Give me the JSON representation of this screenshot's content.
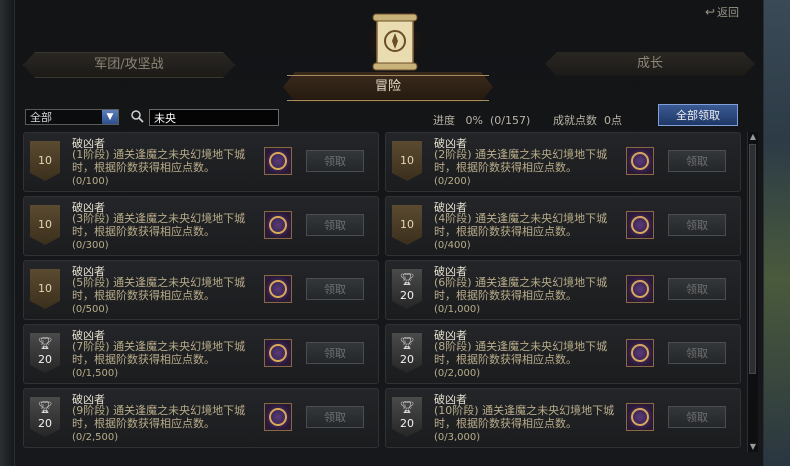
{
  "header": {
    "back_label": "返回",
    "tabs": [
      {
        "label": "军团/攻坚战"
      },
      {
        "label": "冒险"
      },
      {
        "label": "成长"
      }
    ]
  },
  "filter": {
    "dropdown_value": "全部",
    "search_value": "未央"
  },
  "summary": {
    "progress_label": "进度",
    "progress_value": "0%",
    "progress_count": "(0/157)",
    "points_label": "成就点数",
    "points_value": "0点",
    "claim_all_label": "全部领取"
  },
  "cards": [
    {
      "title": "破凶者",
      "desc": "(1阶段) 通关逢魔之未央幻境地下城时，根据阶数获得相应点数。",
      "progress": "(0/100)",
      "badge": "10",
      "claim": "领取"
    },
    {
      "title": "破凶者",
      "desc": "(2阶段) 通关逢魔之未央幻境地下城时，根据阶数获得相应点数。",
      "progress": "(0/200)",
      "badge": "10",
      "claim": "领取"
    },
    {
      "title": "破凶者",
      "desc": "(3阶段) 通关逢魔之未央幻境地下城时，根据阶数获得相应点数。",
      "progress": "(0/300)",
      "badge": "10",
      "claim": "领取"
    },
    {
      "title": "破凶者",
      "desc": "(4阶段) 通关逢魔之未央幻境地下城时，根据阶数获得相应点数。",
      "progress": "(0/400)",
      "badge": "10",
      "claim": "领取"
    },
    {
      "title": "破凶者",
      "desc": "(5阶段) 通关逢魔之未央幻境地下城时，根据阶数获得相应点数。",
      "progress": "(0/500)",
      "badge": "10",
      "claim": "领取"
    },
    {
      "title": "破凶者",
      "desc": "(6阶段) 通关逢魔之未央幻境地下城时，根据阶数获得相应点数。",
      "progress": "(0/1,000)",
      "badge": "20",
      "claim": "领取"
    },
    {
      "title": "破凶者",
      "desc": "(7阶段) 通关逢魔之未央幻境地下城时，根据阶数获得相应点数。",
      "progress": "(0/1,500)",
      "badge": "20",
      "claim": "领取"
    },
    {
      "title": "破凶者",
      "desc": "(8阶段) 通关逢魔之未央幻境地下城时，根据阶数获得相应点数。",
      "progress": "(0/2,000)",
      "badge": "20",
      "claim": "领取"
    },
    {
      "title": "破凶者",
      "desc": "(9阶段) 通关逢魔之未央幻境地下城时，根据阶数获得相应点数。",
      "progress": "(0/2,500)",
      "badge": "20",
      "claim": "领取"
    },
    {
      "title": "破凶者",
      "desc": "(10阶段) 通关逢魔之未央幻境地下城时，根据阶数获得相应点数。",
      "progress": "(0/3,000)",
      "badge": "20",
      "claim": "领取"
    }
  ]
}
